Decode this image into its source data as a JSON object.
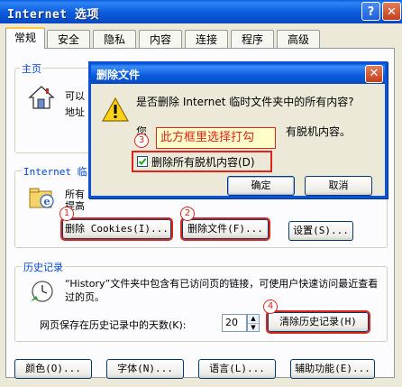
{
  "window": {
    "title": "Internet 选项",
    "help_glyph": "?",
    "close_glyph": "✕"
  },
  "tabs": [
    {
      "label": "常规",
      "active": true
    },
    {
      "label": "安全",
      "active": false
    },
    {
      "label": "隐私",
      "active": false
    },
    {
      "label": "内容",
      "active": false
    },
    {
      "label": "连接",
      "active": false
    },
    {
      "label": "程序",
      "active": false
    },
    {
      "label": "高级",
      "active": false
    }
  ],
  "homepage": {
    "legend": "主页",
    "line1": "可以",
    "line2": "地址"
  },
  "temp_files": {
    "legend": "Internet 临",
    "line1": "所有",
    "line2": "提高",
    "delete_cookies_label": "删除 Cookies(I)...",
    "delete_files_label": "删除文件(F)...",
    "settings_label": "设置(S)..."
  },
  "history": {
    "legend": "历史记录",
    "description": "“History”文件夹中包含有已访问页的链接，可使用户快速访问最近查看过的页。",
    "days_label": "网页保存在历史记录中的天数(K):",
    "days_value": "20",
    "clear_label": "清除历史记录(H)"
  },
  "bottom_buttons": {
    "colors": "颜色(O)...",
    "fonts": "字体(N)...",
    "languages": "语言(L)...",
    "accessibility": "辅助功能(E)..."
  },
  "dialog": {
    "title": "删除文件",
    "question": "是否删除 Internet 临时文件夹中的所有内容?",
    "subtext_prefix": "您",
    "subtext_suffix": "有脱机内容。",
    "checkbox_label": "删除所有脱机内容(D)",
    "checkbox_checked": true,
    "ok_label": "确定",
    "cancel_label": "取消"
  },
  "annotations": {
    "tooltip": "此方框里选择打勾",
    "n1": "1",
    "n2": "2",
    "n3": "3",
    "n4": "4"
  },
  "colors": {
    "accent_red": "#E0231B",
    "title_blue": "#0A5BDC",
    "legend_blue": "#0046D5"
  }
}
